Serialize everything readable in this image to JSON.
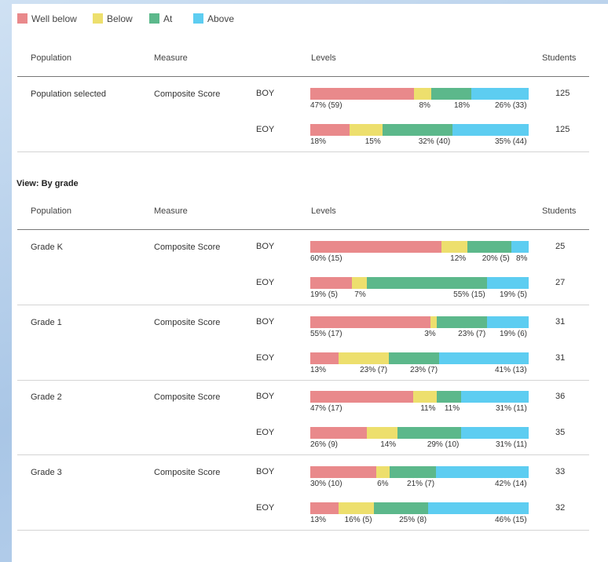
{
  "legend": [
    {
      "key": "wb",
      "label": "Well below",
      "color": "#e9898b"
    },
    {
      "key": "bl",
      "label": "Below",
      "color": "#eddf6d"
    },
    {
      "key": "at",
      "label": "At",
      "color": "#5cb88b"
    },
    {
      "key": "ab",
      "label": "Above",
      "color": "#5dcdf1"
    }
  ],
  "columns": {
    "population": "Population",
    "measure": "Measure",
    "levels": "Levels",
    "students": "Students"
  },
  "summary": {
    "population": "Population selected",
    "measure": "Composite Score",
    "rows": [
      {
        "period": "BOY",
        "students": "125",
        "segments": [
          {
            "pct": 47,
            "label": "47% (59)"
          },
          {
            "pct": 8,
            "label": "8%"
          },
          {
            "pct": 18,
            "label": "18%"
          },
          {
            "pct": 26,
            "label": "26% (33)"
          }
        ]
      },
      {
        "period": "EOY",
        "students": "125",
        "segments": [
          {
            "pct": 18,
            "label": "18%"
          },
          {
            "pct": 15,
            "label": "15%"
          },
          {
            "pct": 32,
            "label": "32% (40)"
          },
          {
            "pct": 35,
            "label": "35% (44)"
          }
        ]
      }
    ]
  },
  "view_label": "View: By grade",
  "grades": [
    {
      "population": "Grade K",
      "measure": "Composite Score",
      "rows": [
        {
          "period": "BOY",
          "students": "25",
          "segments": [
            {
              "pct": 60,
              "label": "60% (15)"
            },
            {
              "pct": 12,
              "label": "12%"
            },
            {
              "pct": 20,
              "label": "20% (5)"
            },
            {
              "pct": 8,
              "label": "8%"
            }
          ]
        },
        {
          "period": "EOY",
          "students": "27",
          "segments": [
            {
              "pct": 19,
              "label": "19% (5)"
            },
            {
              "pct": 7,
              "label": "7%"
            },
            {
              "pct": 55,
              "label": "55% (15)"
            },
            {
              "pct": 19,
              "label": "19% (5)"
            }
          ]
        }
      ]
    },
    {
      "population": "Grade 1",
      "measure": "Composite Score",
      "rows": [
        {
          "period": "BOY",
          "students": "31",
          "segments": [
            {
              "pct": 55,
              "label": "55% (17)"
            },
            {
              "pct": 3,
              "label": "3%"
            },
            {
              "pct": 23,
              "label": "23% (7)"
            },
            {
              "pct": 19,
              "label": "19% (6)"
            }
          ]
        },
        {
          "period": "EOY",
          "students": "31",
          "segments": [
            {
              "pct": 13,
              "label": "13%"
            },
            {
              "pct": 23,
              "label": "23% (7)"
            },
            {
              "pct": 23,
              "label": "23% (7)"
            },
            {
              "pct": 41,
              "label": "41% (13)"
            }
          ]
        }
      ]
    },
    {
      "population": "Grade 2",
      "measure": "Composite Score",
      "rows": [
        {
          "period": "BOY",
          "students": "36",
          "segments": [
            {
              "pct": 47,
              "label": "47% (17)"
            },
            {
              "pct": 11,
              "label": "11%"
            },
            {
              "pct": 11,
              "label": "11%"
            },
            {
              "pct": 31,
              "label": "31% (11)"
            }
          ]
        },
        {
          "period": "EOY",
          "students": "35",
          "segments": [
            {
              "pct": 26,
              "label": "26% (9)"
            },
            {
              "pct": 14,
              "label": "14%"
            },
            {
              "pct": 29,
              "label": "29% (10)"
            },
            {
              "pct": 31,
              "label": "31% (11)"
            }
          ]
        }
      ]
    },
    {
      "population": "Grade 3",
      "measure": "Composite Score",
      "rows": [
        {
          "period": "BOY",
          "students": "33",
          "segments": [
            {
              "pct": 30,
              "label": "30% (10)"
            },
            {
              "pct": 6,
              "label": "6%"
            },
            {
              "pct": 21,
              "label": "21% (7)"
            },
            {
              "pct": 42,
              "label": "42% (14)"
            }
          ]
        },
        {
          "period": "EOY",
          "students": "32",
          "segments": [
            {
              "pct": 13,
              "label": "13%"
            },
            {
              "pct": 16,
              "label": "16% (5)"
            },
            {
              "pct": 25,
              "label": "25% (8)"
            },
            {
              "pct": 46,
              "label": "46% (15)"
            }
          ]
        }
      ]
    }
  ]
}
